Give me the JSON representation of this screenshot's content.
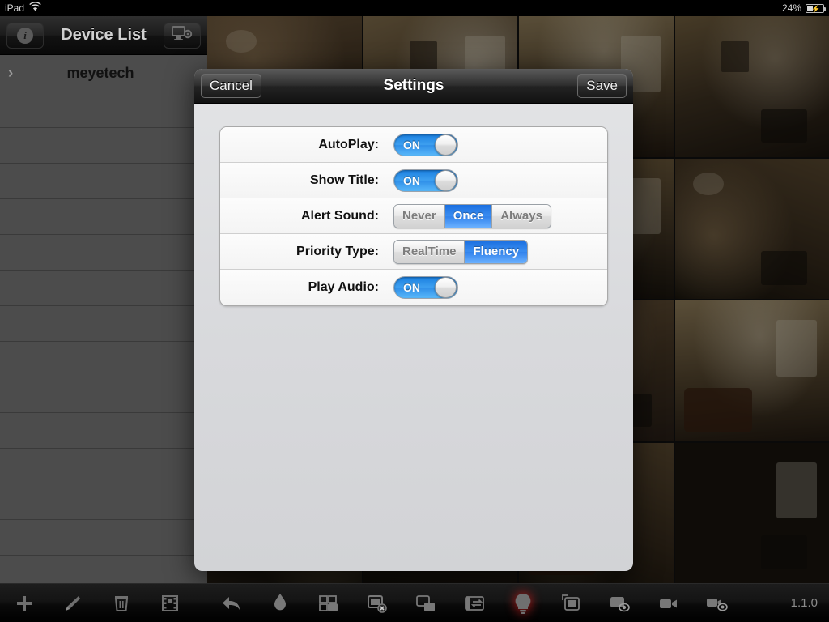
{
  "status_bar": {
    "device_label": "iPad",
    "wifi_icon": "wifi-icon",
    "battery_percent": "24%",
    "battery_icon": "battery-charging-icon"
  },
  "left_panel": {
    "navbar": {
      "info_button_icon": "info-circle-icon",
      "info_button_label": "i",
      "title": "Device List",
      "settings_button_icon": "monitor-gear-icon"
    },
    "rows": [
      {
        "name": "meyetech",
        "chevron": "chevron-right-icon"
      },
      {
        "name": "",
        "chevron": ""
      },
      {
        "name": "",
        "chevron": ""
      },
      {
        "name": "",
        "chevron": ""
      },
      {
        "name": "",
        "chevron": ""
      },
      {
        "name": "",
        "chevron": ""
      },
      {
        "name": "",
        "chevron": ""
      },
      {
        "name": "",
        "chevron": ""
      },
      {
        "name": "",
        "chevron": ""
      },
      {
        "name": "",
        "chevron": ""
      },
      {
        "name": "",
        "chevron": ""
      },
      {
        "name": "",
        "chevron": ""
      },
      {
        "name": "",
        "chevron": ""
      },
      {
        "name": "",
        "chevron": ""
      },
      {
        "name": "",
        "chevron": ""
      }
    ]
  },
  "modal": {
    "cancel_label": "Cancel",
    "title": "Settings",
    "save_label": "Save",
    "rows": [
      {
        "label": "AutoPlay:",
        "control": "toggle",
        "value": "ON"
      },
      {
        "label": "Show Title:",
        "control": "toggle",
        "value": "ON"
      },
      {
        "label": "Alert Sound:",
        "control": "segmented",
        "options": [
          "Never",
          "Once",
          "Always"
        ],
        "selected": "Once"
      },
      {
        "label": "Priority Type:",
        "control": "segmented",
        "options": [
          "RealTime",
          "Fluency"
        ],
        "selected": "Fluency"
      },
      {
        "label": "Play Audio:",
        "control": "toggle",
        "value": "ON"
      }
    ]
  },
  "toolbar": {
    "left_buttons": [
      {
        "icon": "plus-icon"
      },
      {
        "icon": "pencil-edit-icon"
      },
      {
        "icon": "trash-icon"
      },
      {
        "icon": "film-strip-icon"
      }
    ],
    "right_buttons": [
      {
        "icon": "back-arrow-icon"
      },
      {
        "icon": "ptz-control-icon"
      },
      {
        "icon": "multi-window-open-icon"
      },
      {
        "icon": "close-window-icon"
      },
      {
        "icon": "window-pair-icon"
      },
      {
        "icon": "swap-stream-icon"
      },
      {
        "icon": "alarm-bulb-icon",
        "active": true
      },
      {
        "icon": "single-window-icon"
      },
      {
        "icon": "snapshot-icon"
      },
      {
        "icon": "record-video-icon"
      },
      {
        "icon": "playback-icon"
      }
    ],
    "version": "1.1.0"
  },
  "colors": {
    "accent_blue": "#3b8df0",
    "toggle_on": "#2f8fe8",
    "alarm_red": "#dc1e1e",
    "panel_gray": "#4c4c4c",
    "navbar_black": "#121212"
  }
}
